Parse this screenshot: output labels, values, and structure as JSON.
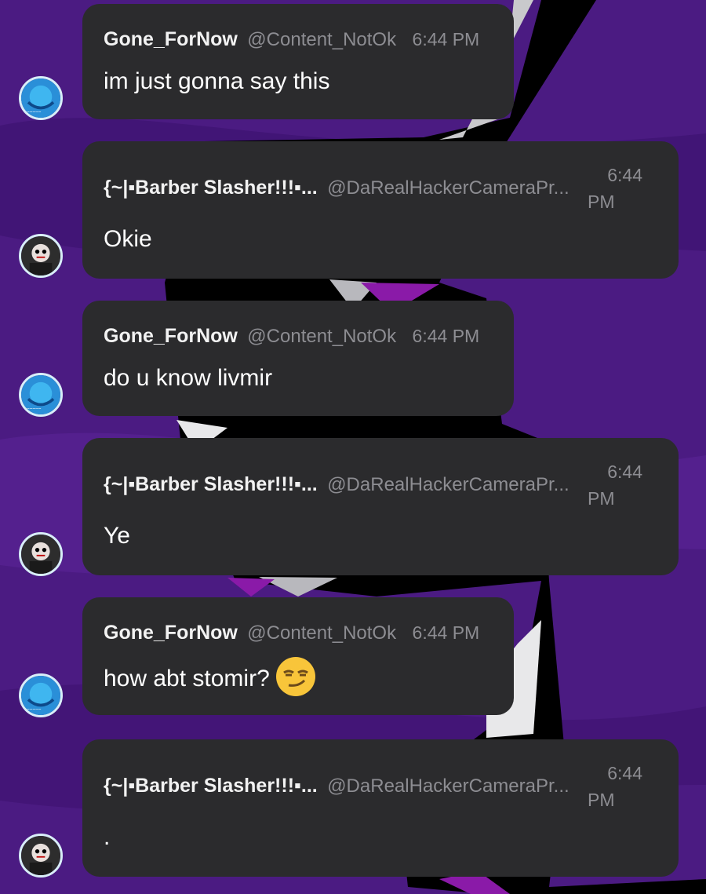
{
  "users": {
    "gone": {
      "name": "Gone_ForNow",
      "handle": "@Content_NotOk"
    },
    "barber": {
      "name": "{~|▪Barber Slasher!!!▪...",
      "handle": "@DaRealHackerCameraPr..."
    }
  },
  "messages": [
    {
      "user": "gone",
      "time": "6:44 PM",
      "text": "im just gonna say this"
    },
    {
      "user": "barber",
      "time_hour": "6:44",
      "time_ampm": "PM",
      "text": "Okie"
    },
    {
      "user": "gone",
      "time": "6:44 PM",
      "text": "do u know livmir"
    },
    {
      "user": "barber",
      "time_hour": "6:44",
      "time_ampm": "PM",
      "text": "Ye"
    },
    {
      "user": "gone",
      "time": "6:44 PM",
      "text": "how abt stomir?",
      "emoji": "smirking-face-emoji"
    },
    {
      "user": "barber",
      "time_hour": "6:44",
      "time_ampm": "PM",
      "text": "."
    }
  ],
  "colors": {
    "bubble": "#2b2b2d",
    "background_purple": "#4a1a80",
    "name_text": "#f2f2f2",
    "meta_text": "#8d8d92"
  }
}
